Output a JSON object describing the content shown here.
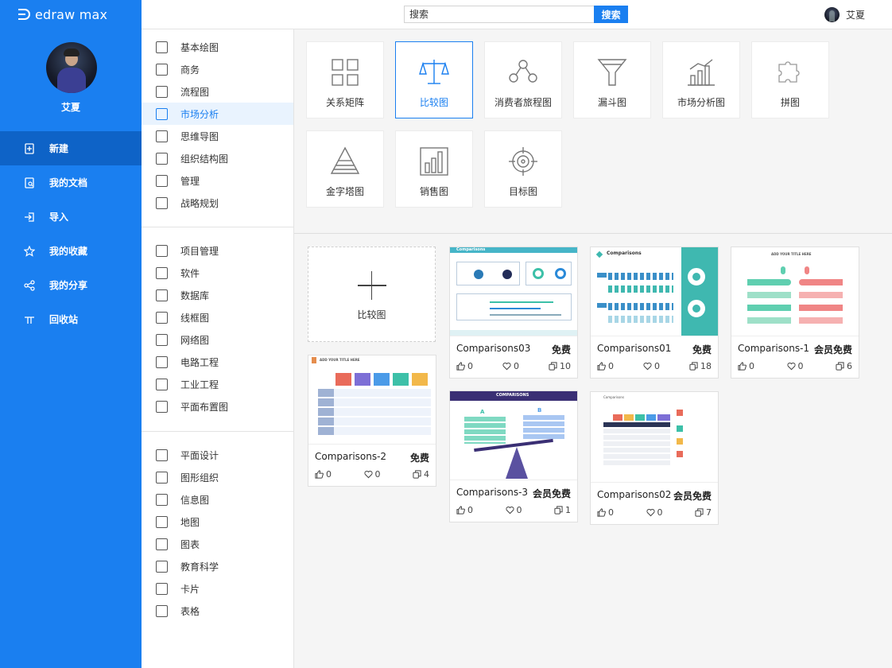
{
  "app": {
    "logo_text": "edraw max"
  },
  "user": {
    "name": "艾夏"
  },
  "nav": [
    {
      "label": "新建",
      "icon": "new-file-icon",
      "active": true
    },
    {
      "label": "我的文档",
      "icon": "document-icon",
      "active": false
    },
    {
      "label": "导入",
      "icon": "import-icon",
      "active": false
    },
    {
      "label": "我的收藏",
      "icon": "star-icon",
      "active": false
    },
    {
      "label": "我的分享",
      "icon": "share-icon",
      "active": false
    },
    {
      "label": "回收站",
      "icon": "trash-icon",
      "active": false
    }
  ],
  "search": {
    "placeholder": "搜索",
    "button": "搜索"
  },
  "categories": {
    "group1": [
      "基本绘图",
      "商务",
      "流程图",
      "市场分析",
      "思维导图",
      "组织结构图",
      "管理",
      "战略规划"
    ],
    "group2": [
      "项目管理",
      "软件",
      "数据库",
      "线框图",
      "网络图",
      "电路工程",
      "工业工程",
      "平面布置图"
    ],
    "group3": [
      "平面设计",
      "图形组织",
      "信息图",
      "地图",
      "图表",
      "教育科学",
      "卡片",
      "表格"
    ],
    "active": "市场分析"
  },
  "types": [
    "关系矩阵",
    "比较图",
    "消费者旅程图",
    "漏斗图",
    "市场分析图",
    "拼图",
    "金字塔图",
    "销售图",
    "目标图"
  ],
  "active_type": "比较图",
  "new_card": {
    "label": "比较图"
  },
  "templates": [
    {
      "name": "Comparisons03",
      "price": "免费",
      "likes": "0",
      "favs": "0",
      "copies": "10"
    },
    {
      "name": "Comparisons01",
      "price": "免费",
      "likes": "0",
      "favs": "0",
      "copies": "18"
    },
    {
      "name": "Comparisons-1",
      "price": "会员免费",
      "likes": "0",
      "favs": "0",
      "copies": "6"
    },
    {
      "name": "Comparisons-2",
      "price": "免费",
      "likes": "0",
      "favs": "0",
      "copies": "4"
    },
    {
      "name": "Comparisons-3",
      "price": "会员免费",
      "likes": "0",
      "favs": "0",
      "copies": "1"
    },
    {
      "name": "Comparisons02",
      "price": "会员免费",
      "likes": "0",
      "favs": "0",
      "copies": "7"
    }
  ],
  "thumb_text": {
    "t1_title": "Comparisons",
    "t2_title": "Comparisons",
    "t3_title": "ADD YOUR TITLE HERE",
    "t4_title": "ADD YOUR TITLE HERE",
    "t5_title": "COMPARISONS",
    "t5_a": "A",
    "t5_b": "B",
    "t6_title": "Comparisons"
  },
  "colors": {
    "brand": "#1a7ff0",
    "brand_dark": "#0e63c7",
    "teal": "#3fb8b0"
  }
}
